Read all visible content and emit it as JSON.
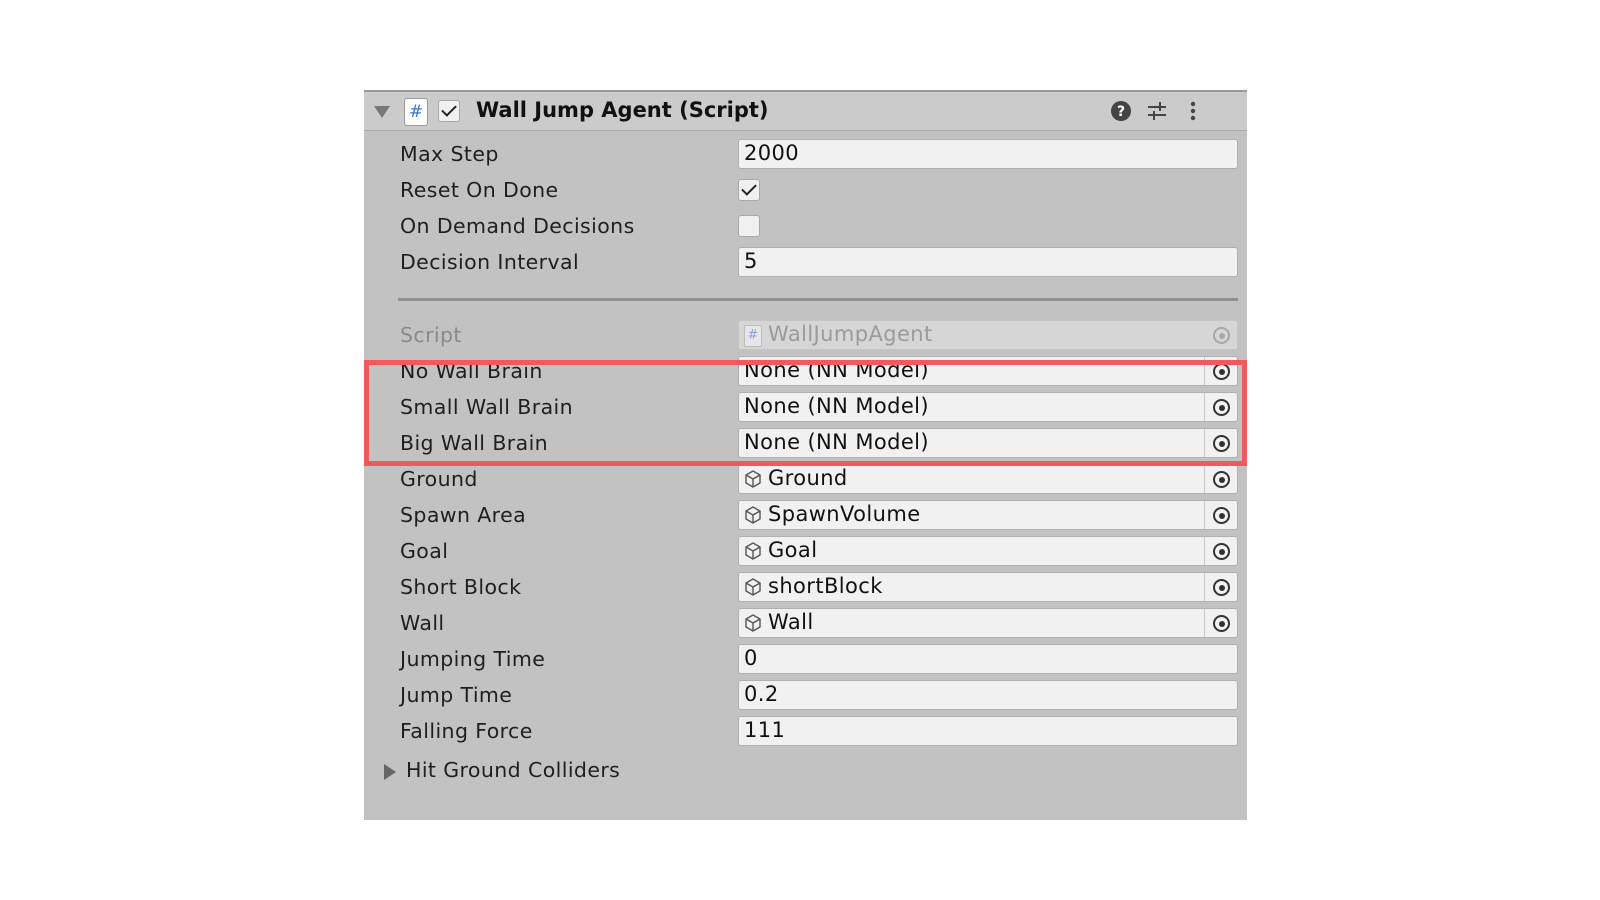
{
  "component": {
    "title": "Wall Jump Agent (Script)",
    "enabled": true
  },
  "fields": {
    "max_step": {
      "label": "Max Step",
      "value": "2000"
    },
    "reset_on_done": {
      "label": "Reset On Done",
      "checked": true
    },
    "on_demand_decisions": {
      "label": "On Demand Decisions",
      "checked": false
    },
    "decision_interval": {
      "label": "Decision Interval",
      "value": "5"
    },
    "script": {
      "label": "Script",
      "value": "WallJumpAgent"
    },
    "no_wall_brain": {
      "label": "No Wall Brain",
      "value": "None (NN Model)"
    },
    "small_wall_brain": {
      "label": "Small Wall Brain",
      "value": "None (NN Model)"
    },
    "big_wall_brain": {
      "label": "Big Wall Brain",
      "value": "None (NN Model)"
    },
    "ground": {
      "label": "Ground",
      "value": "Ground"
    },
    "spawn_area": {
      "label": "Spawn Area",
      "value": "SpawnVolume"
    },
    "goal": {
      "label": "Goal",
      "value": "Goal"
    },
    "short_block": {
      "label": "Short Block",
      "value": "shortBlock"
    },
    "wall": {
      "label": "Wall",
      "value": "Wall"
    },
    "jumping_time": {
      "label": "Jumping Time",
      "value": "0"
    },
    "jump_time": {
      "label": "Jump Time",
      "value": "0.2"
    },
    "falling_force": {
      "label": "Falling Force",
      "value": "111"
    },
    "hit_ground_colliders": {
      "label": "Hit Ground Colliders"
    }
  },
  "icons": {
    "header": [
      "foldout-arrow-icon",
      "script-hash-icon",
      "help-icon",
      "presets-icon",
      "more-options-icon"
    ],
    "object_picker": "object-picker-icon",
    "gameobject": "cube-icon"
  },
  "colors": {
    "panel_bg": "#c2c2c2",
    "field_bg": "#f1f1f1",
    "highlight": "#f05a5a",
    "script_icon": "#3f73c9"
  }
}
